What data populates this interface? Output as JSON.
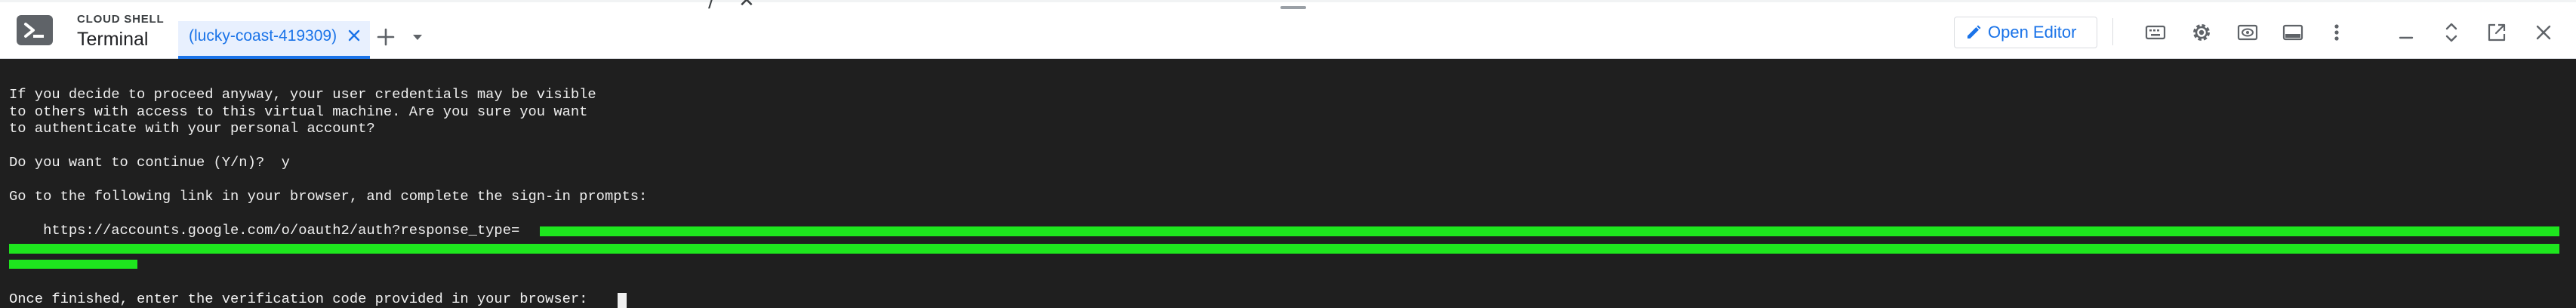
{
  "header": {
    "product_label": "CLOUD SHELL",
    "panel_title": "Terminal",
    "tab": {
      "label": "(lucky-coast-419309)"
    },
    "open_editor_label": "Open Editor",
    "colors": {
      "accent": "#1a73e8",
      "tab_background": "#e8f0fe",
      "icon": "#5f6368"
    },
    "icons": [
      "cloud-shell-icon",
      "close-tab-icon",
      "add-tab-icon",
      "tab-menu-chevron-icon",
      "pencil-icon",
      "keyboard-icon",
      "settings-gear-icon",
      "web-preview-icon",
      "layout-icon",
      "more-vert-icon",
      "minimize-icon",
      "expand-icon",
      "open-new-window-icon",
      "close-icon"
    ]
  },
  "terminal": {
    "background": "#1f1f1f",
    "text_color": "#f0f0f0",
    "redaction_color": "#1ee61e",
    "lines": [
      "If you decide to proceed anyway, your user credentials may be visible",
      "to others with access to this virtual machine. Are you sure you want",
      "to authenticate with your personal account?",
      "",
      "Do you want to continue (Y/n)?  y",
      "",
      "Go to the following link in your browser, and complete the sign-in prompts:",
      "",
      "    https://accounts.google.com/o/oauth2/auth?response_type=",
      "",
      "",
      "",
      "Once finished, enter the verification code provided in your browser: "
    ]
  }
}
